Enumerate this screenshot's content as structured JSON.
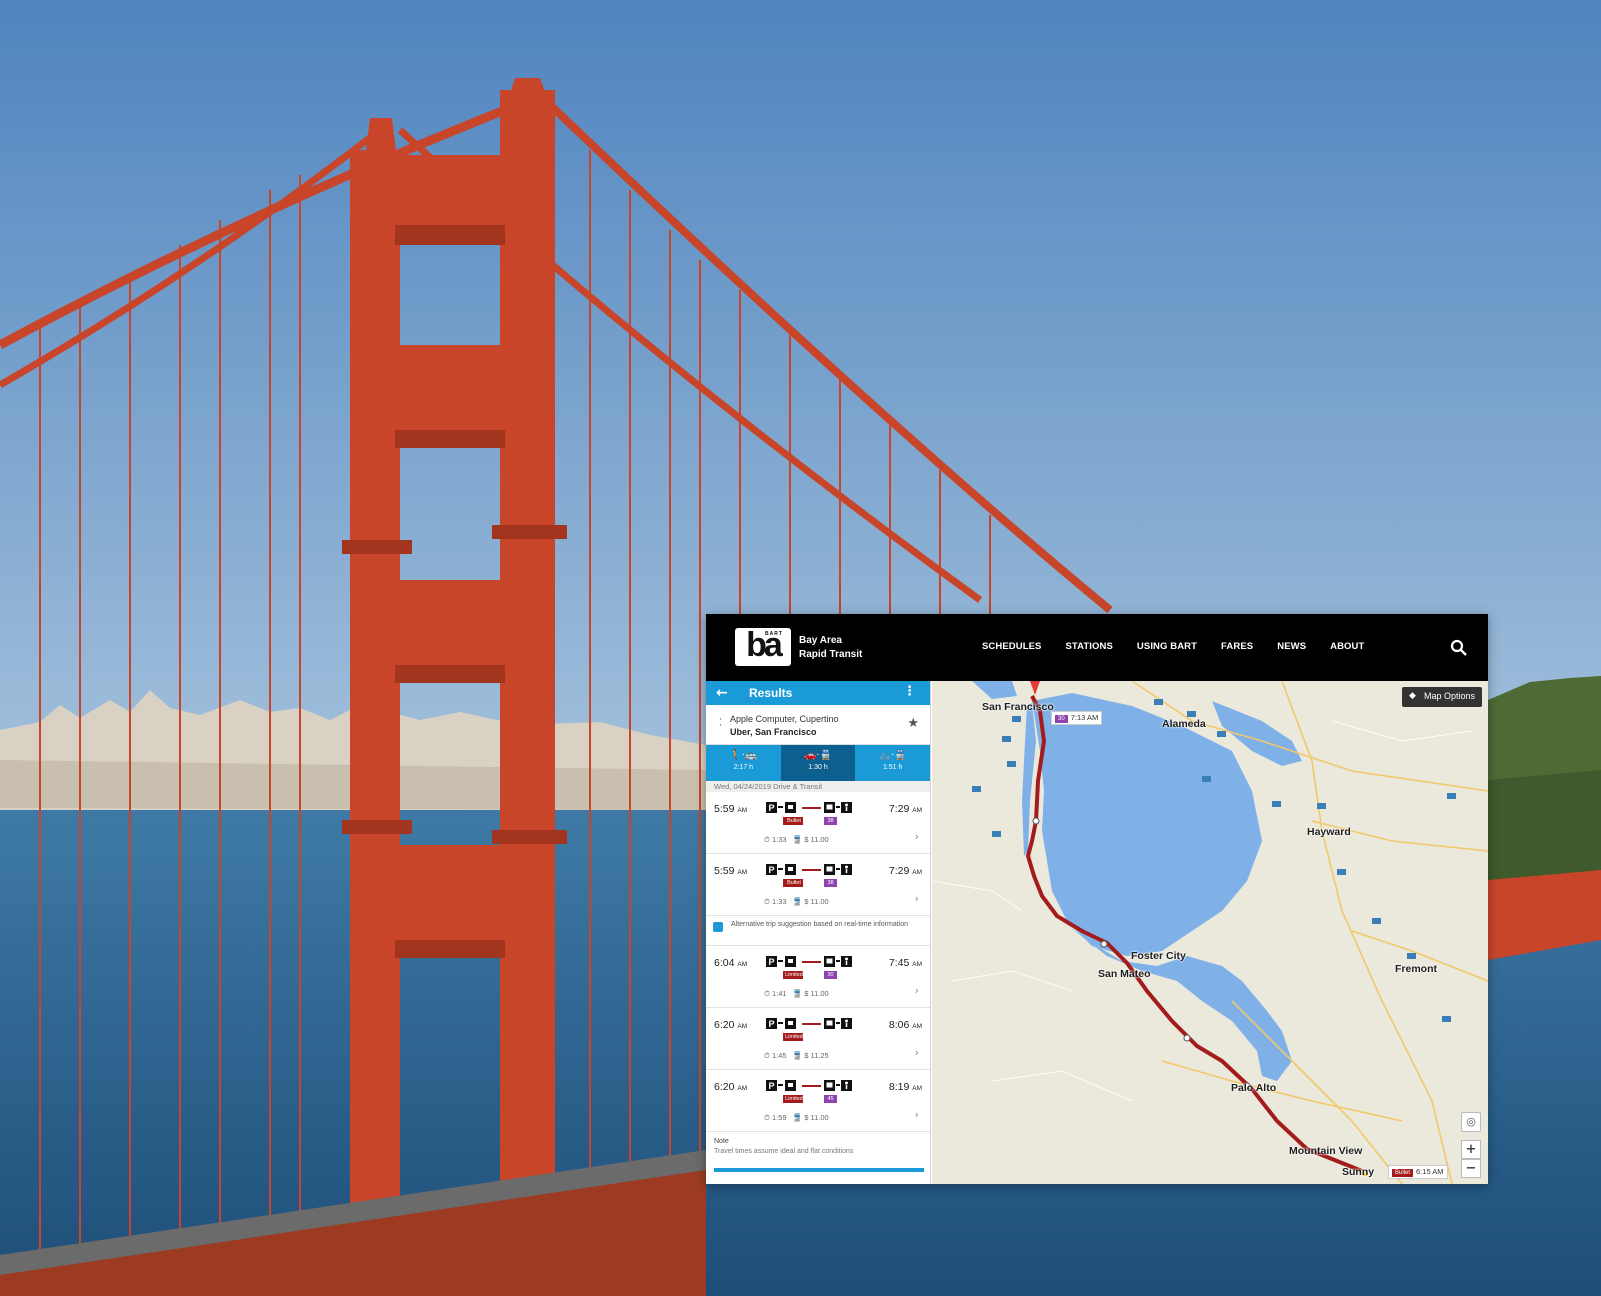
{
  "header": {
    "logo_text": "ba",
    "logo_small": "BART",
    "brand_line1": "Bay Area",
    "brand_line2": "Rapid Transit",
    "nav": [
      "SCHEDULES",
      "STATIONS",
      "USING BART",
      "FARES",
      "NEWS",
      "ABOUT"
    ]
  },
  "results": {
    "title": "Results",
    "from": "Apple Computer, Cupertino",
    "to": "Uber, San Francisco",
    "modes": [
      {
        "time": "2:17 h"
      },
      {
        "time": "1:30 h"
      },
      {
        "time": "1:51 h"
      }
    ],
    "date_line": "Wed, 04/24/2019 Drive & Transit",
    "trips": [
      {
        "depart": "5:59",
        "depart_ampm": "AM",
        "arrive": "7:29",
        "arrive_ampm": "AM",
        "badge1": "Bullet",
        "badge2": "38",
        "duration": "1:33",
        "fare": "$ 11.00"
      },
      {
        "depart": "5:59",
        "depart_ampm": "AM",
        "arrive": "7:29",
        "arrive_ampm": "AM",
        "badge1": "Bullet",
        "badge2": "38",
        "duration": "1:33",
        "fare": "$ 11.00"
      },
      {
        "depart": "6:04",
        "depart_ampm": "AM",
        "arrive": "7:45",
        "arrive_ampm": "AM",
        "badge1": "Limited",
        "badge2": "30",
        "duration": "1:41",
        "fare": "$ 11.00"
      },
      {
        "depart": "6:20",
        "depart_ampm": "AM",
        "arrive": "8:06",
        "arrive_ampm": "AM",
        "badge1": "Limited",
        "badge2": "",
        "duration": "1:45",
        "fare": "$ 11.25"
      },
      {
        "depart": "6:20",
        "depart_ampm": "AM",
        "arrive": "8:19",
        "arrive_ampm": "AM",
        "badge1": "Limited",
        "badge2": "45",
        "duration": "1:59",
        "fare": "$ 11.00"
      }
    ],
    "alert": "Alternative trip suggestion based on real-time information",
    "note_title": "Note",
    "note_text": "Travel times assume ideal and flat conditions"
  },
  "map": {
    "options_label": "Map Options",
    "labels": {
      "sf": "San Francisco",
      "alameda": "Alameda",
      "hayward": "Hayward",
      "foster": "Foster City",
      "sanmateo": "San Mateo",
      "fremont": "Fremont",
      "paloalto": "Palo Alto",
      "mountainview": "Mountain View",
      "sunny": "Sunny"
    },
    "time_top": "7:13 AM",
    "time_top_badge": "30",
    "time_bottom": "6:15 AM",
    "time_bottom_badge": "Bullet",
    "zoom_in": "+",
    "zoom_out": "−"
  },
  "colors": {
    "bart_blue": "#1a9ad6",
    "route_red": "#a31b1b",
    "bay_water": "#7fb1e8",
    "bridge_orange": "#c8452a"
  }
}
